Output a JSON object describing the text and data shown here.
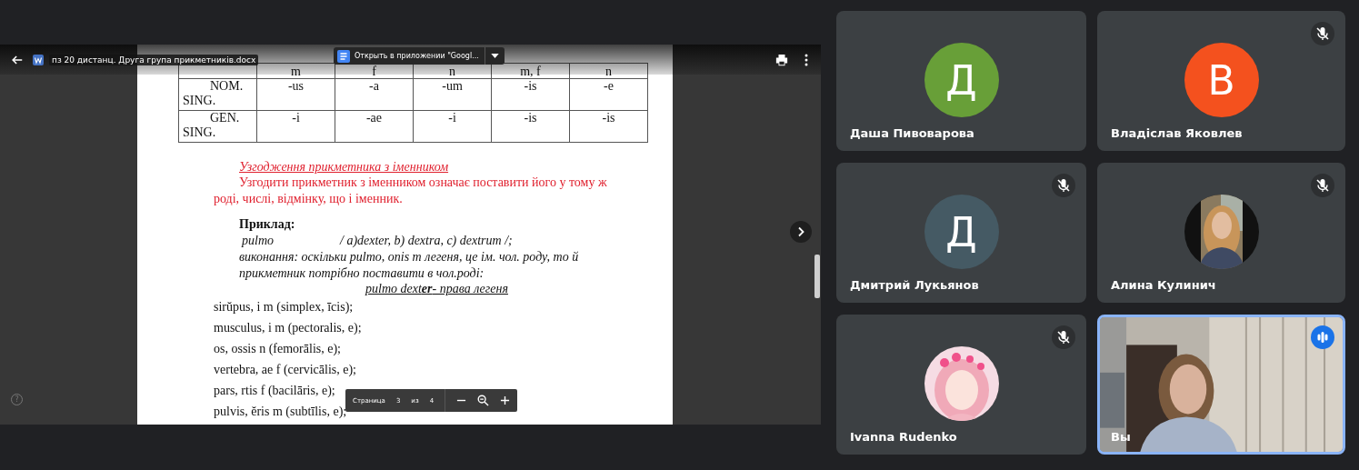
{
  "viewer": {
    "file_name": "пз 20 дистанц. Друга група прикметників.docx",
    "open_in_app": "Открыть в приложении \"Googl...",
    "help": "?",
    "page_control": {
      "label": "Страница",
      "current": "3",
      "of": "из",
      "total": "4"
    }
  },
  "document": {
    "table": {
      "columns": [
        "",
        "m",
        "f",
        "n",
        "m, f",
        "n"
      ],
      "rows": [
        [
          "NOM. SING.",
          "-us",
          "-a",
          "-um",
          "-is",
          "-e"
        ],
        [
          "GEN. SING.",
          "-i",
          "-ae",
          "-i",
          "-is",
          "-is"
        ]
      ]
    },
    "heading": "Узгодження прикметника з іменником",
    "rule": "Узгодити прикметник з іменником означає поставити його у тому ж роді, числі, відмінку, що і іменник.",
    "example_label": "Приклад:",
    "example_word": "pulmo",
    "example_options": "/ a)dexter, b) dextra, c) dextrum /;",
    "example_lines": [
      "виконання: оскільки pulmo, onis m легеня, це ім. чол. роду, то й",
      "прикметник потрібно поставити в чол.роді:"
    ],
    "result": "pulmo dext**er**- права легеня",
    "exercises": [
      "sirŭpus, i m (simplex, īcis);",
      "musculus, i m (pectoralis, e);",
      "os, ossis n (femorālis, e);",
      "vertebra, ae f (cervicālis, e);",
      "pars, rtis f (bacilāris, e);",
      "pulvis, ĕris m (subtīlis, e);"
    ]
  },
  "participants": [
    {
      "name": "Даша Пивоварова",
      "muted": false,
      "speaking": false,
      "avatar": {
        "kind": "letter",
        "letter": "Д",
        "color": "#689f38"
      }
    },
    {
      "name": "Владіслав Яковлев",
      "muted": true,
      "speaking": false,
      "avatar": {
        "kind": "letter",
        "letter": "В",
        "color": "#f4511e"
      }
    },
    {
      "name": "Дмитрий Лукьянов",
      "muted": true,
      "speaking": false,
      "avatar": {
        "kind": "letter",
        "letter": "Д",
        "color": "#455a64"
      }
    },
    {
      "name": "Алина Кулинич",
      "muted": true,
      "speaking": false
    },
    {
      "name": "Ivanna Rudenko",
      "muted": true,
      "speaking": false,
      "avatar": {
        "kind": "cartoon"
      }
    },
    {
      "name": "Вы",
      "muted": false,
      "speaking": true,
      "avatar": {
        "kind": "video"
      }
    }
  ]
}
